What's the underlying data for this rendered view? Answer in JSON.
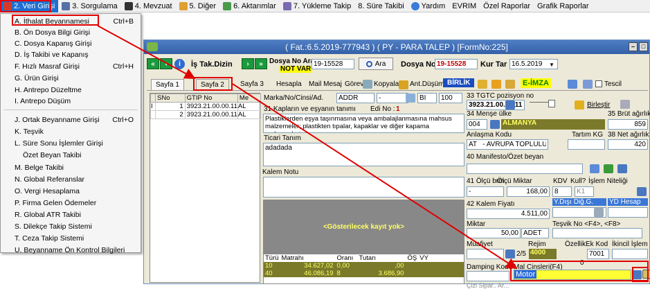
{
  "menubar": {
    "items": [
      "2. Veri Girişi",
      "3. Sorgulama",
      "4. Mevzuat",
      "5. Diğer",
      "6. Aktarımlar",
      "7. Yükleme Takip",
      "8. Süre Takibi",
      "Yardım",
      "EVRIM",
      "Özel Raporlar",
      "Grafik Raporlar"
    ]
  },
  "dropdown": {
    "items": [
      {
        "label": "A. İthalat Beyannamesi",
        "shortcut": "Ctrl+B"
      },
      {
        "label": "B. Ön Dosya Bilgi Girişi",
        "shortcut": ""
      },
      {
        "label": "C. Dosya Kapanış Girişi",
        "shortcut": ""
      },
      {
        "label": "D. İş Takibi ve Kapanış",
        "shortcut": ""
      },
      {
        "label": "F. Hızlı Masraf Girişi",
        "shortcut": "Ctrl+H"
      },
      {
        "label": "G. Ürün Girişi",
        "shortcut": ""
      },
      {
        "label": "H. Antrepo Düzeltme",
        "shortcut": ""
      },
      {
        "label": "I. Antrepo Düşüm",
        "shortcut": ""
      },
      {
        "label": "J. Ortak Beyanname Girişi",
        "shortcut": "Ctrl+O"
      },
      {
        "label": "K. Teşvik",
        "shortcut": ""
      },
      {
        "label": "L. Süre Sonu İşlemler Girişi",
        "shortcut": ""
      },
      {
        "label": "Özet Beyan Takibi",
        "shortcut": ""
      },
      {
        "label": "M. Belge Takibi",
        "shortcut": ""
      },
      {
        "label": "N. Global Referanslar",
        "shortcut": ""
      },
      {
        "label": "O. Vergi Hesaplama",
        "shortcut": ""
      },
      {
        "label": "P. Firma Gelen Ödemeler",
        "shortcut": ""
      },
      {
        "label": "R. Global ATR Takibi",
        "shortcut": ""
      },
      {
        "label": "S. Dilekçe Takip Sistemi",
        "shortcut": ""
      },
      {
        "label": "T. Ceza Takip Sistemi",
        "shortcut": ""
      },
      {
        "label": "U. Beyanname Ön Kontrol Bilgileri",
        "shortcut": ""
      }
    ]
  },
  "window": {
    "title": "( Fat.:6.5.2019-777943 ) ( PY  - PARA TALEP ) [FormNo:225]",
    "is_tak_dizin": "İş Tak.Dizin",
    "dosya_no_ara_label": "Dosya No Ara",
    "dosya_no_ara_value": "19-15528",
    "not_var": "NOT VAR",
    "ara_button": "Ara",
    "dosya_no_label": "Dosya No",
    "dosya_no_value": "19-15528",
    "kur_tar_label": "Kur Tar",
    "kur_tar_value": "16.5.2019"
  },
  "tabs": [
    "Sayfa 1",
    "Sayfa 2",
    "Sayfa 3",
    "Hesapla",
    "Mail Mesaj",
    "Görev",
    "Kopyala",
    "Ant.Düşüm",
    "BİRLİK",
    "E-İMZA",
    "Tescil"
  ],
  "kalem_grid": {
    "headers": [
      "SNo",
      "GTIP No",
      "Me"
    ],
    "rows": [
      {
        "flag": "I",
        "sno": "1",
        "gtip": "3923.21.00.00.11",
        "me": "AL"
      },
      {
        "flag": "",
        "sno": "2",
        "gtip": "3923.21.00.00.11",
        "me": "AL"
      }
    ]
  },
  "mid": {
    "marka_label": "Marka/No/Cinsi/Ad.",
    "marka_value": "ADDR",
    "marka_dash": "-",
    "bi_value": "BI",
    "qty_value": "100",
    "kaplar_label": "31 Kapların ve eşyanın tanımı",
    "edi_label": "Edi No :",
    "edi_value": "1",
    "kaplar_text": "Plastiklerden eşya taşınmasına veya ambalajlanmasına mahsus malzemeler; plastikten tıpalar, kapaklar ve diğer kapama malzemeleri",
    "ticari_label": "Ticari Tanım",
    "ticari_value": "adadada",
    "kalem_notu_label": "Kalem Notu",
    "no_record": "<Gösterilecek kayıt yok>",
    "tax_headers": [
      "Türü",
      "Matrahı",
      "Oranı",
      "Tutarı",
      "ÖŞ",
      "VY"
    ],
    "tax_rows": [
      {
        "tur": "10",
        "matrah": "34.627,02",
        "oran": "0,00",
        "tutar": ",00"
      },
      {
        "tur": "40",
        "matrah": "46.086,19",
        "oran": "8",
        "tutar": "3.686,90"
      }
    ]
  },
  "right": {
    "gtip_label": "33 TGTC pozisyon no",
    "gtip_value": "3923.21.00.00.11",
    "birlestir": "Birleştir",
    "mense_label": "34 Menşe ülke",
    "mense_code": "004",
    "mense_name": "ALMANYA",
    "brut_label": "35 Brüt ağırlık",
    "brut_value": "859",
    "anlasma_label": "Anlaşma Kodu",
    "anlasma_value": "AT   - AVRUPA TOPLULUĞU",
    "tartim_label": "Tartım KG",
    "net_label": "38 Net ağırlık",
    "net_value": "420",
    "manifesto_label": "40 Manifesto/Özet beyan",
    "olcu_label": "41 Ölçü brm",
    "olcu_miktar_label": "Ölçü Miktar",
    "kdv_label": "KDV",
    "kull_label": "Kull?",
    "islem_label": "İşlem Niteliği",
    "olcu_value": "-",
    "olcu_miktar_value": "168,00",
    "kdv_value": "8",
    "kull_value": "K1",
    "kalem_fiyat_label": "42 Kalem Fiyatı",
    "kalem_fiyat_value": "4.511,00",
    "ydisi_label": "Y.Dışı Diğ.G.",
    "yd_hesap_label": "YD Hesap",
    "miktar_label": "Miktar",
    "miktar_value": "50,00",
    "miktar_unit": "ADET",
    "tesvik_label": "Teşvik No <F4>, <F8>",
    "muafiyet_label": "Muafiyet",
    "rejim_label": "Rejim",
    "ozellik_label": "ÖzellikEk Kod",
    "ikincil_label": "İkincil İşlem",
    "sayfa_value": "2/5",
    "rejim_value": "4000",
    "ek_kod_value": "7001",
    "ozellik_small": "0",
    "damping_label": "Damping Kodu",
    "mal_cinsleri_label": "Mal Cinsleri(F4)",
    "mal_cinsleri_value": "Motor",
    "bottom_cut": "Çizi Sipar.. Ar..."
  },
  "colors": {
    "accent": "#1e6fd0",
    "highlight_red": "#e00000",
    "field_yellow": "#ffff33",
    "olive": "#7a7a2a"
  }
}
